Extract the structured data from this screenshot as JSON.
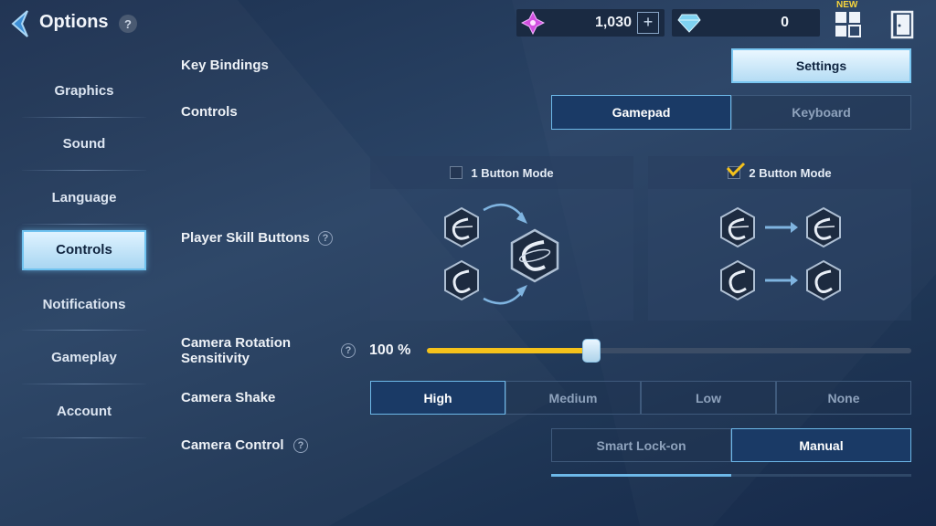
{
  "header": {
    "title": "Options",
    "help": "?",
    "gems_purple": "1,030",
    "plus": "+",
    "gems_blue": "0",
    "new_badge": "NEW"
  },
  "sidebar": {
    "items": [
      {
        "label": "Graphics"
      },
      {
        "label": "Sound"
      },
      {
        "label": "Language"
      },
      {
        "label": "Controls"
      },
      {
        "label": "Notifications"
      },
      {
        "label": "Gameplay"
      },
      {
        "label": "Account"
      }
    ],
    "active_index": 3
  },
  "settings": {
    "key_bindings": {
      "label": "Key Bindings",
      "button": "Settings"
    },
    "controls": {
      "label": "Controls",
      "options": [
        "Gamepad",
        "Keyboard"
      ],
      "selected": "Gamepad"
    },
    "player_skill_buttons": {
      "label": "Player Skill Buttons",
      "help": "?",
      "modes": [
        {
          "label": "1 Button Mode",
          "checked": false
        },
        {
          "label": "2 Button Mode",
          "checked": true
        }
      ]
    },
    "camera_rotation": {
      "label_line1": "Camera Rotation",
      "label_line2": "Sensitivity",
      "help": "?",
      "value_text": "100 %",
      "value_fraction": 0.34
    },
    "camera_shake": {
      "label": "Camera Shake",
      "options": [
        "High",
        "Medium",
        "Low",
        "None"
      ],
      "selected": "High"
    },
    "camera_control": {
      "label": "Camera Control",
      "help": "?",
      "options": [
        "Smart Lock-on",
        "Manual"
      ],
      "selected": "Manual"
    }
  },
  "colors": {
    "accent_yellow": "#f5c21b",
    "accent_blue": "#6db8e8",
    "bg_dark": "#1d3150"
  }
}
